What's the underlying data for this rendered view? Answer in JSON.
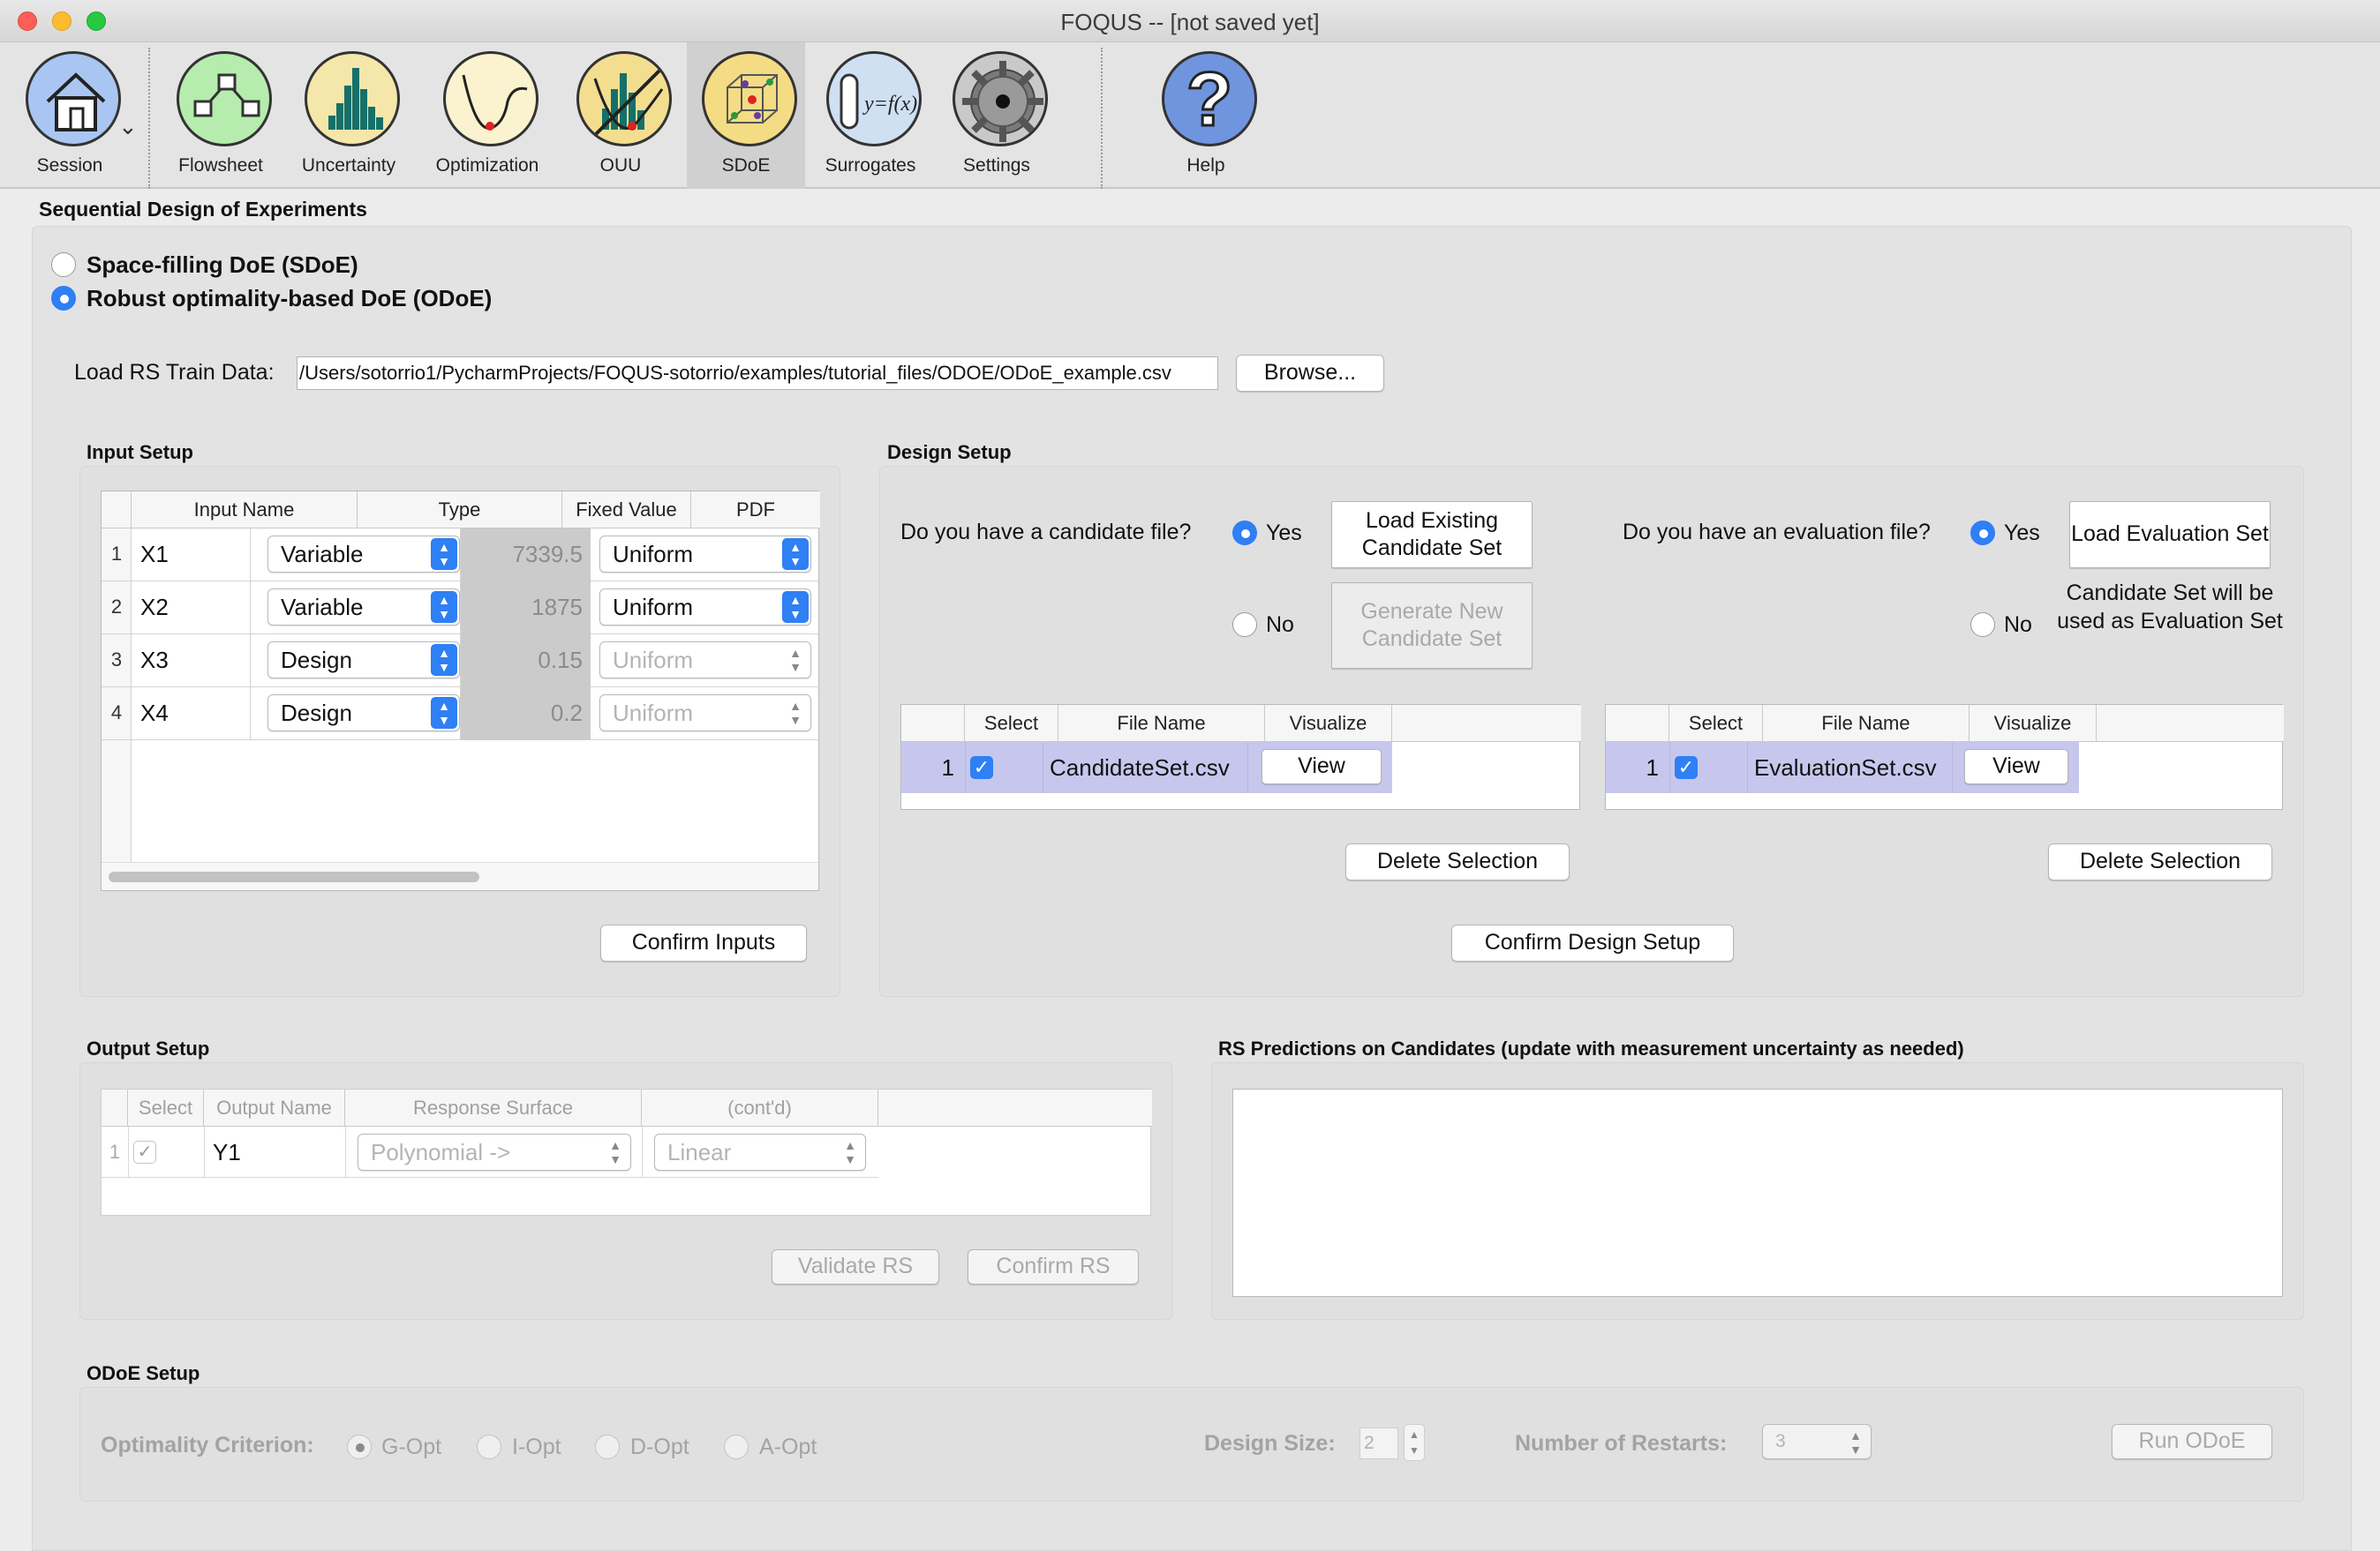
{
  "window": {
    "title": "FOQUS -- [not saved yet]"
  },
  "toolbar": {
    "items": [
      {
        "label": "Session",
        "icon": "house-icon"
      },
      {
        "label": "Flowsheet",
        "icon": "flowsheet-icon"
      },
      {
        "label": "Uncertainty",
        "icon": "histogram-icon"
      },
      {
        "label": "Optimization",
        "icon": "optimization-curve-icon"
      },
      {
        "label": "OUU",
        "icon": "ouu-icon"
      },
      {
        "label": "SDoE",
        "icon": "sdoe-cube-icon"
      },
      {
        "label": "Surrogates",
        "icon": "surrogate-function-icon"
      },
      {
        "label": "Settings",
        "icon": "gear-icon"
      },
      {
        "label": "Help",
        "icon": "help-question-icon"
      }
    ],
    "active": "SDoE",
    "session_chevron": "⌄",
    "surrogate_text": "y=f(x)",
    "help_glyph": "?"
  },
  "page": {
    "title": "Sequential Design of Experiments",
    "mode_sdoe": "Space-filling DoE (SDoE)",
    "mode_odoe": "Robust optimality-based DoE (ODoE)",
    "load_label": "Load RS Train Data:",
    "load_path": "/Users/sotorrio1/PycharmProjects/FOQUS-sotorrio/examples/tutorial_files/ODOE/ODoE_example.csv",
    "browse": "Browse..."
  },
  "input_setup": {
    "title": "Input Setup",
    "headers": [
      "Input Name",
      "Type",
      "Fixed Value",
      "PDF"
    ],
    "rows": [
      {
        "n": "1",
        "name": "X1",
        "type": "Variable",
        "fixed": "7339.5",
        "pdf": "Uniform"
      },
      {
        "n": "2",
        "name": "X2",
        "type": "Variable",
        "fixed": "1875",
        "pdf": "Uniform"
      },
      {
        "n": "3",
        "name": "X3",
        "type": "Design",
        "fixed": "0.15",
        "pdf": "Uniform"
      },
      {
        "n": "4",
        "name": "X4",
        "type": "Design",
        "fixed": "0.2",
        "pdf": "Uniform"
      }
    ],
    "confirm": "Confirm Inputs"
  },
  "design_setup": {
    "title": "Design Setup",
    "cand_q": "Do you have a candidate file?",
    "eval_q": "Do you have an evaluation file?",
    "yes": "Yes",
    "no": "No",
    "load_cand": "Load Existing Candidate Set",
    "gen_cand": "Generate New Candidate Set",
    "load_eval": "Load Evaluation Set",
    "eval_note": "Candidate Set will be used as Evaluation Set",
    "headers": [
      "Select",
      "File Name",
      "Visualize"
    ],
    "cand_row": {
      "n": "1",
      "file": "CandidateSet.csv",
      "view": "View"
    },
    "eval_row": {
      "n": "1",
      "file": "EvaluationSet.csv",
      "view": "View"
    },
    "delete": "Delete Selection",
    "confirm": "Confirm Design Setup"
  },
  "output_setup": {
    "title": "Output Setup",
    "headers": [
      "Select",
      "Output Name",
      "Response Surface",
      "(cont'd)"
    ],
    "row": {
      "n": "1",
      "name": "Y1",
      "rs": "Polynomial ->",
      "cont": "Linear"
    },
    "validate": "Validate RS",
    "confirm": "Confirm RS"
  },
  "rs_pred": {
    "title": "RS Predictions on Candidates (update with measurement uncertainty as needed)"
  },
  "odoe_setup": {
    "title": "ODoE Setup",
    "criterion": "Optimality Criterion:",
    "options": [
      "G-Opt",
      "I-Opt",
      "D-Opt",
      "A-Opt"
    ],
    "design_size": "Design Size:",
    "design_size_val": "2",
    "restarts": "Number of Restarts:",
    "restarts_val": "3",
    "run": "Run ODoE"
  }
}
